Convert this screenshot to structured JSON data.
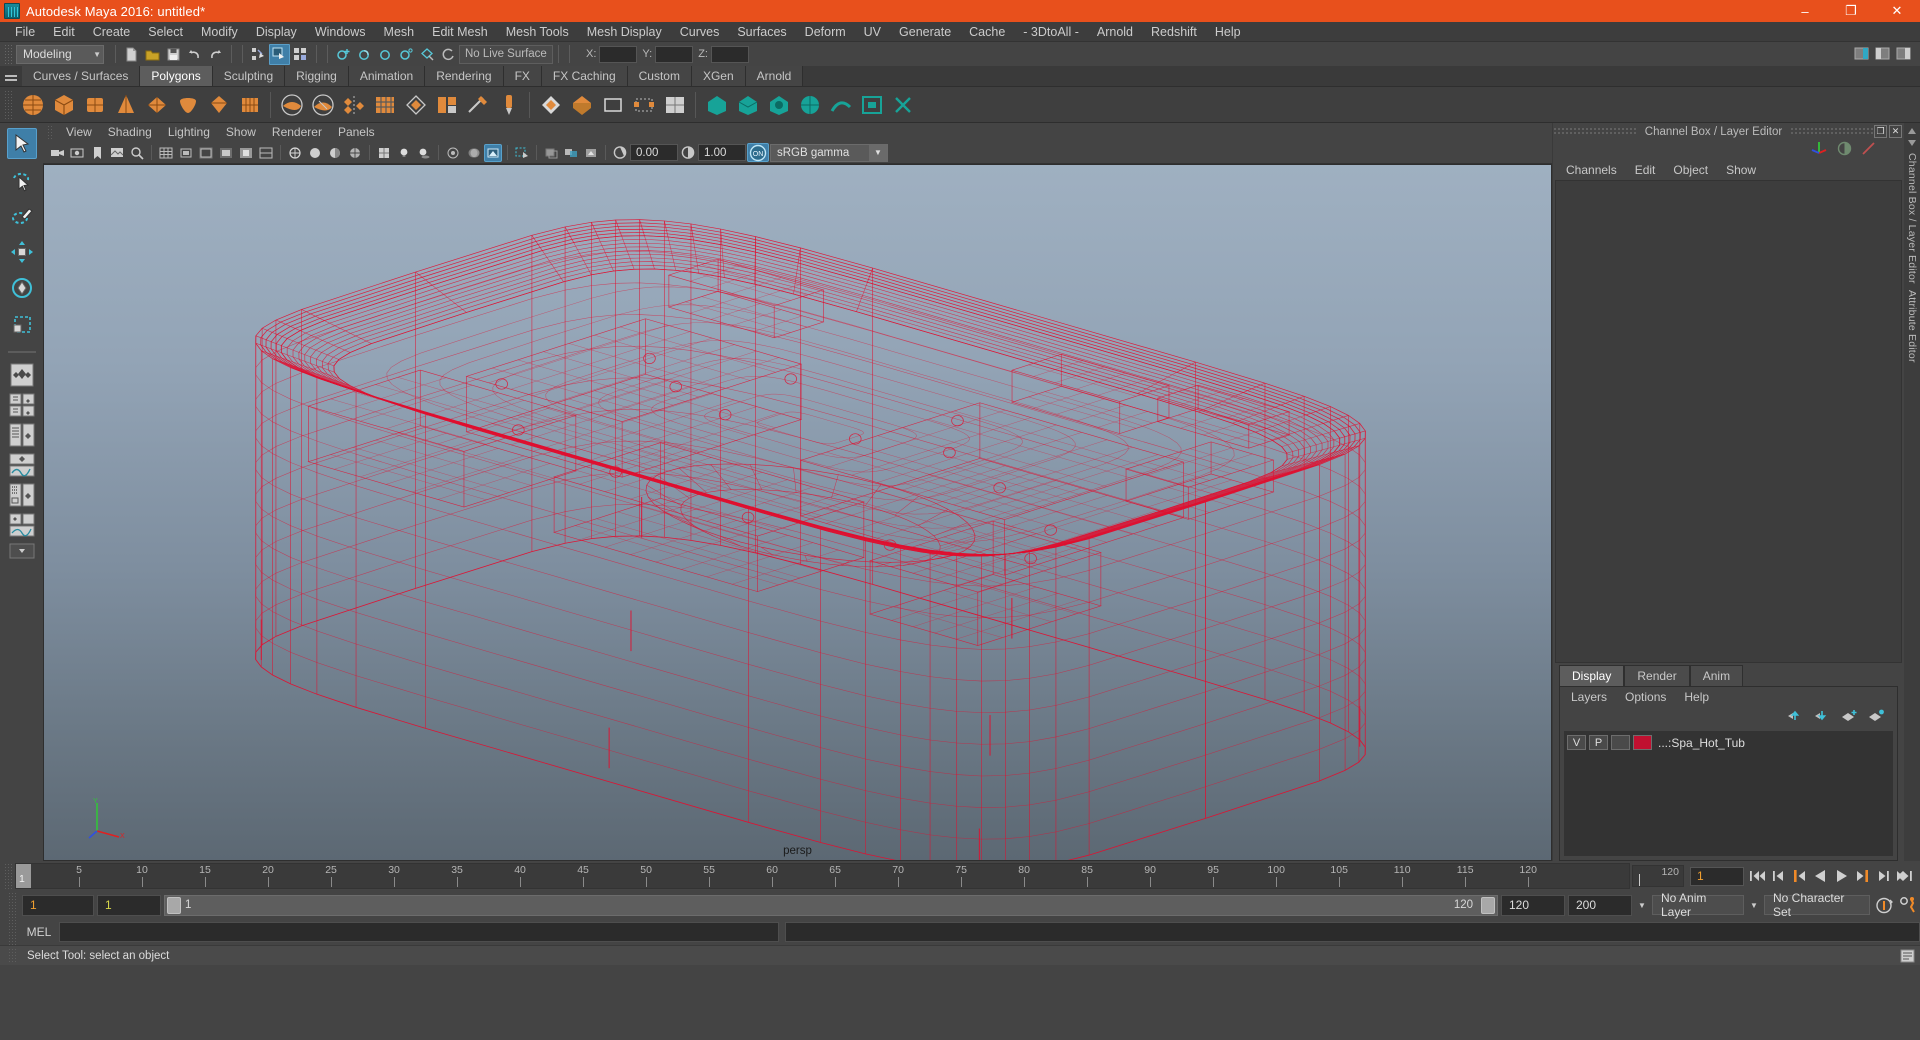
{
  "window": {
    "title": "Autodesk Maya 2016: untitled*",
    "minimize": "–",
    "maximize": "❐",
    "close": "✕"
  },
  "menubar": {
    "items": [
      "File",
      "Edit",
      "Create",
      "Select",
      "Modify",
      "Display",
      "Windows",
      "Mesh",
      "Edit Mesh",
      "Mesh Tools",
      "Mesh Display",
      "Curves",
      "Surfaces",
      "Deform",
      "UV",
      "Generate",
      "Cache",
      "- 3DtoAll -",
      "Arnold",
      "Redshift",
      "Help"
    ]
  },
  "statusline": {
    "menu_set": "Modeling",
    "live_surface": "No Live Surface",
    "coord_labels": [
      "X:",
      "Y:",
      "Z:"
    ],
    "coord_values": [
      "",
      "",
      ""
    ]
  },
  "shelf": {
    "tabs": [
      "Curves / Surfaces",
      "Polygons",
      "Sculpting",
      "Rigging",
      "Animation",
      "Rendering",
      "FX",
      "FX Caching",
      "Custom",
      "XGen",
      "Arnold"
    ],
    "active_tab": "Polygons"
  },
  "viewport": {
    "menus": [
      "View",
      "Shading",
      "Lighting",
      "Show",
      "Renderer",
      "Panels"
    ],
    "exposure": "0.00",
    "gamma": "1.00",
    "gamma_toggle": "ON",
    "color_profile": "sRGB gamma",
    "camera_label": "persp",
    "axis_labels": {
      "y": "Y",
      "x": "X",
      "z": "Z"
    },
    "model_color": "#e01030",
    "bg_top": "#9fb0c1",
    "bg_bottom": "#5c6873"
  },
  "channelbox": {
    "panel_title": "Channel Box / Layer Editor",
    "menus": [
      "Channels",
      "Edit",
      "Object",
      "Show"
    ],
    "restore_glyph": "❐",
    "close_glyph": "✕"
  },
  "layer_editor": {
    "tabs": [
      "Display",
      "Render",
      "Anim"
    ],
    "active_tab": "Display",
    "menus": [
      "Layers",
      "Options",
      "Help"
    ],
    "layers": [
      {
        "visibility": "V",
        "playback": "P",
        "shade": "",
        "color": "#c01030",
        "name": "...:Spa_Hot_Tub"
      }
    ]
  },
  "dock": {
    "labels": [
      "Channel Box / Layer Editor",
      "Attribute Editor"
    ]
  },
  "timeline": {
    "ticks": [
      5,
      10,
      15,
      20,
      25,
      30,
      35,
      40,
      45,
      50,
      55,
      60,
      65,
      70,
      75,
      80,
      85,
      90,
      95,
      100,
      105,
      110,
      115,
      120
    ],
    "current_frame": "1",
    "current_frame_field": "1",
    "end_marker": "120",
    "playback_buttons": [
      "go-to-start",
      "step-back-key",
      "step-back-frame",
      "play-backwards",
      "play-forwards",
      "step-forward-frame",
      "step-forward-key",
      "go-to-end"
    ]
  },
  "range": {
    "start": "1",
    "anim_start": "1",
    "slider_left_label": "1",
    "slider_right_label": "120",
    "range_end": "120",
    "anim_end": "200",
    "anim_layer": "No Anim Layer",
    "character_set": "No Character Set"
  },
  "command_line": {
    "language": "MEL",
    "input_value": "",
    "input_placeholder": ""
  },
  "status": {
    "message": "Select Tool: select an object"
  }
}
